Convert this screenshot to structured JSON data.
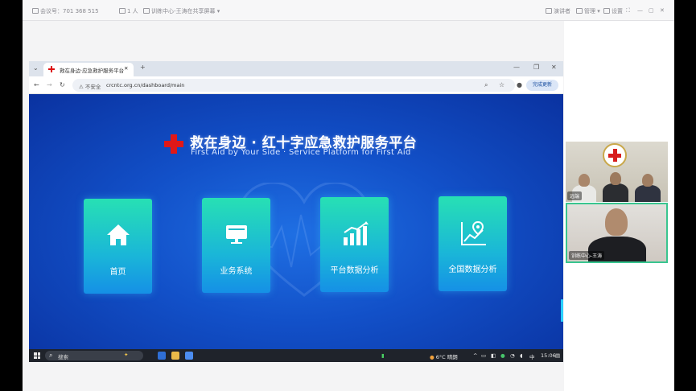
{
  "meeting": {
    "toolbar_left": [
      "会议号：701 368 515",
      "1 人"
    ],
    "meeting_name": "训练中心-王涛在共享屏幕",
    "toolbar_right": [
      "演讲者",
      "管理",
      "设置"
    ]
  },
  "video_tiles": [
    {
      "label": "远端"
    },
    {
      "label": "训练中心-王涛"
    }
  ],
  "browser": {
    "tab_title": "救在身边·应急救护服务平台",
    "security_label": "不安全",
    "url": "crcntc.org.cn/dashboard/main",
    "update_button": "完成更新"
  },
  "app": {
    "title_cn": "救在身边 · 红十字应急救护服务平台",
    "title_en": "First Aid by Your Side · Service Platform for First Aid",
    "colors": {
      "brand_red": "#e01818",
      "card_top": "#27e0b4",
      "card_bottom": "#1590e6",
      "bg_blue": "#1250c8"
    },
    "cards": [
      {
        "label": "首页",
        "icon": "home-icon"
      },
      {
        "label": "业务系统",
        "icon": "monitor-icon"
      },
      {
        "label": "平台数据分析",
        "icon": "bar-chart-icon"
      },
      {
        "label": "全国数据分析",
        "icon": "map-pin-chart-icon"
      }
    ]
  },
  "taskbar": {
    "search_placeholder": "搜索",
    "weather": "6°C 晴朗",
    "ime": "中",
    "time": "15:06"
  }
}
